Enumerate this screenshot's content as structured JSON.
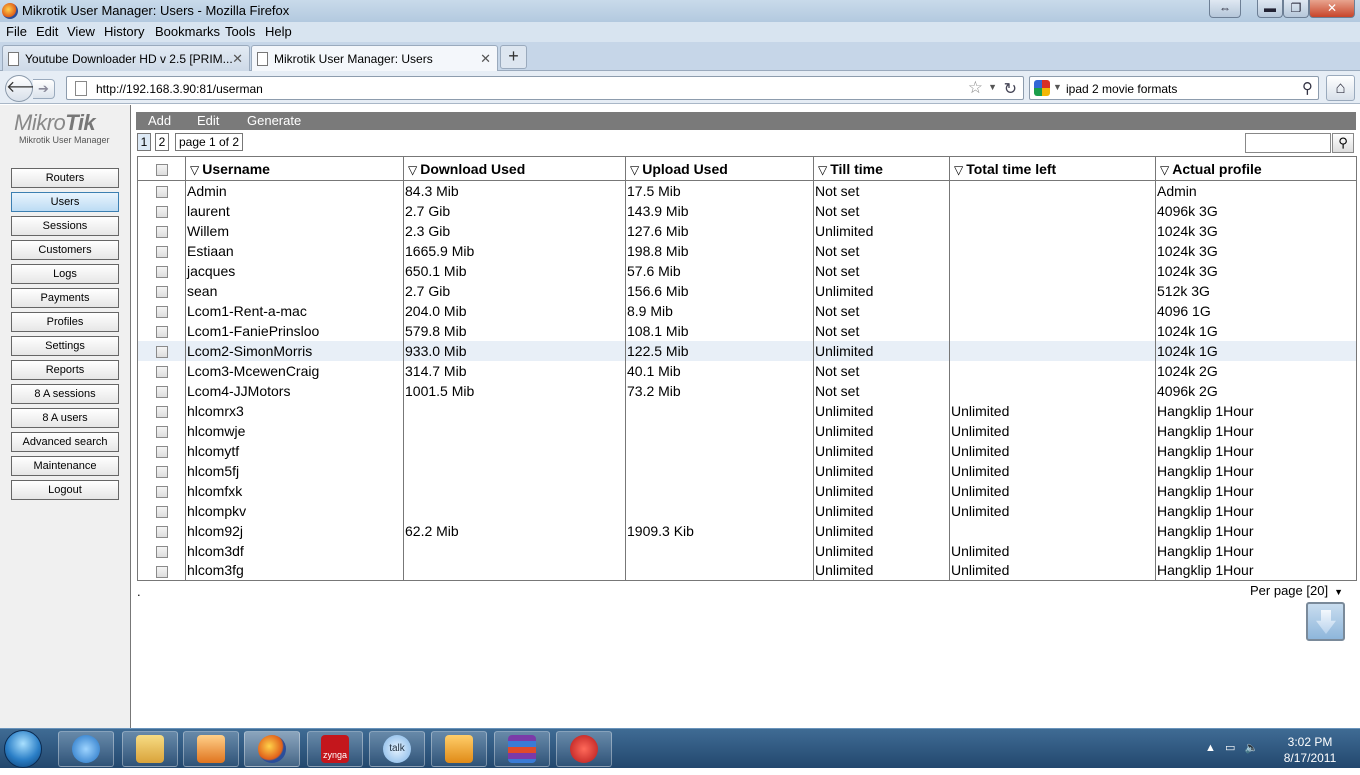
{
  "window": {
    "title": "Mikrotik User Manager: Users - Mozilla Firefox"
  },
  "menu": [
    "File",
    "Edit",
    "View",
    "History",
    "Bookmarks",
    "Tools",
    "Help"
  ],
  "tabs": [
    {
      "label": "Youtube Downloader HD v 2.5 [PRIM...",
      "active": false
    },
    {
      "label": "Mikrotik User Manager: Users",
      "active": true
    }
  ],
  "nav": {
    "url": "http://192.168.3.90:81/userman",
    "search_text": "ipad 2 movie formats"
  },
  "app": {
    "logo": "MikroTik",
    "logo_sub": "Mikrotik User Manager"
  },
  "sidebar": [
    "Routers",
    "Users",
    "Sessions",
    "Customers",
    "Logs",
    "Payments",
    "Profiles",
    "Settings",
    "Reports",
    "8 A sessions",
    "8 A users",
    "Advanced search",
    "Maintenance",
    "Logout"
  ],
  "sidebar_selected": "Users",
  "toolbar": {
    "add": "Add",
    "edit": "Edit",
    "generate": "Generate"
  },
  "pager": {
    "pages": [
      "1",
      "2"
    ],
    "info": "page 1 of 2"
  },
  "columns": [
    "Username",
    "Download Used",
    "Upload Used",
    "Till time",
    "Total time left",
    "Actual profile"
  ],
  "rows": [
    [
      "Admin",
      "84.3 Mib",
      "17.5 Mib",
      "Not set",
      "",
      "Admin"
    ],
    [
      "laurent",
      "2.7 Gib",
      "143.9 Mib",
      "Not set",
      "",
      "4096k 3G"
    ],
    [
      "Willem",
      "2.3 Gib",
      "127.6 Mib",
      "Unlimited",
      "",
      "1024k 3G"
    ],
    [
      "Estiaan",
      "1665.9 Mib",
      "198.8 Mib",
      "Not set",
      "",
      "1024k 3G"
    ],
    [
      "jacques",
      "650.1 Mib",
      "57.6 Mib",
      "Not set",
      "",
      "1024k 3G"
    ],
    [
      "sean",
      "2.7 Gib",
      "156.6 Mib",
      "Unlimited",
      "",
      "512k 3G"
    ],
    [
      "Lcom1-Rent-a-mac",
      "204.0 Mib",
      "8.9 Mib",
      "Not set",
      "",
      "4096 1G"
    ],
    [
      "Lcom1-FaniePrinsloo",
      "579.8 Mib",
      "108.1 Mib",
      "Not set",
      "",
      "1024k 1G"
    ],
    [
      "Lcom2-SimonMorris",
      "933.0 Mib",
      "122.5 Mib",
      "Unlimited",
      "",
      "1024k 1G"
    ],
    [
      "Lcom3-McewenCraig",
      "314.7 Mib",
      "40.1 Mib",
      "Not set",
      "",
      "1024k 2G"
    ],
    [
      "Lcom4-JJMotors",
      "1001.5 Mib",
      "73.2 Mib",
      "Not set",
      "",
      "4096k 2G"
    ],
    [
      "hlcomrx3",
      "",
      "",
      "Unlimited",
      "Unlimited",
      "Hangklip 1Hour"
    ],
    [
      "hlcomwje",
      "",
      "",
      "Unlimited",
      "Unlimited",
      "Hangklip 1Hour"
    ],
    [
      "hlcomytf",
      "",
      "",
      "Unlimited",
      "Unlimited",
      "Hangklip 1Hour"
    ],
    [
      "hlcom5fj",
      "",
      "",
      "Unlimited",
      "Unlimited",
      "Hangklip 1Hour"
    ],
    [
      "hlcomfxk",
      "",
      "",
      "Unlimited",
      "Unlimited",
      "Hangklip 1Hour"
    ],
    [
      "hlcompkv",
      "",
      "",
      "Unlimited",
      "Unlimited",
      "Hangklip 1Hour"
    ],
    [
      "hlcom92j",
      "62.2 Mib",
      "1909.3 Kib",
      "Unlimited",
      "",
      "Hangklip 1Hour"
    ],
    [
      "hlcom3df",
      "",
      "",
      "Unlimited",
      "Unlimited",
      "Hangklip 1Hour"
    ],
    [
      "hlcom3fg",
      "",
      "",
      "Unlimited",
      "Unlimited",
      "Hangklip 1Hour"
    ]
  ],
  "highlighted_row": "Lcom2-SimonMorris",
  "footer": {
    "dot": ".",
    "per_page": "Per page [20]"
  },
  "taskbar": {
    "items": [
      "internet-explorer-icon",
      "folder-icon",
      "media-player-icon",
      "firefox-icon",
      "zynga-icon",
      "google-talk-icon",
      "outlook-icon",
      "winrar-icon",
      "downloader-icon"
    ],
    "zynga_label": "zynga",
    "talk_label": "talk",
    "time": "3:02 PM",
    "date": "8/17/2011"
  }
}
